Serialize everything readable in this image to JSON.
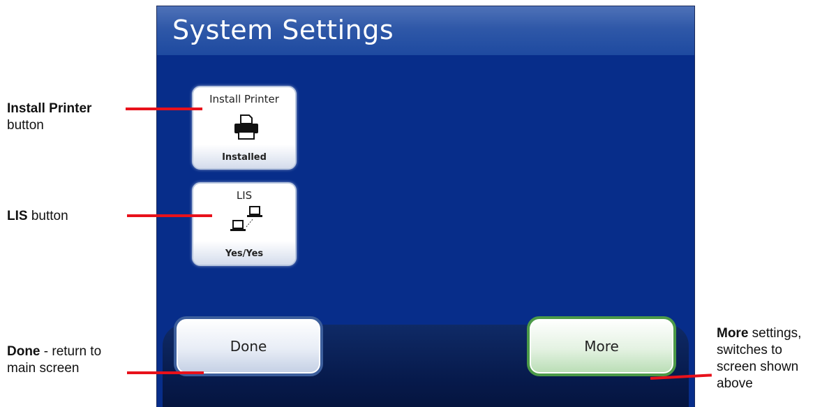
{
  "screen": {
    "title": "System Settings",
    "tiles": [
      {
        "label": "Install Printer",
        "status": "Installed",
        "icon": "printer-icon"
      },
      {
        "label": "LIS",
        "status": "Yes/Yes",
        "icon": "network-computers-icon"
      }
    ],
    "buttons": {
      "done": "Done",
      "more": "More"
    }
  },
  "annotations": {
    "install_printer": {
      "bold": "Install Printer",
      "rest": "button"
    },
    "lis": {
      "bold": "LIS",
      "rest": " button"
    },
    "done": {
      "bold": "Done",
      "rest": " - return to",
      "line2": "main screen"
    },
    "more": {
      "bold": "More",
      "rest": " settings,",
      "line2": "switches to",
      "line3": "screen shown",
      "line4": "above"
    }
  },
  "colors": {
    "screen_bg": "#072d8a",
    "title_bar": "#2f58a8",
    "done_border": "#3c5e9c",
    "more_border": "#4c9a48",
    "annotation_line": "#e8111b"
  }
}
